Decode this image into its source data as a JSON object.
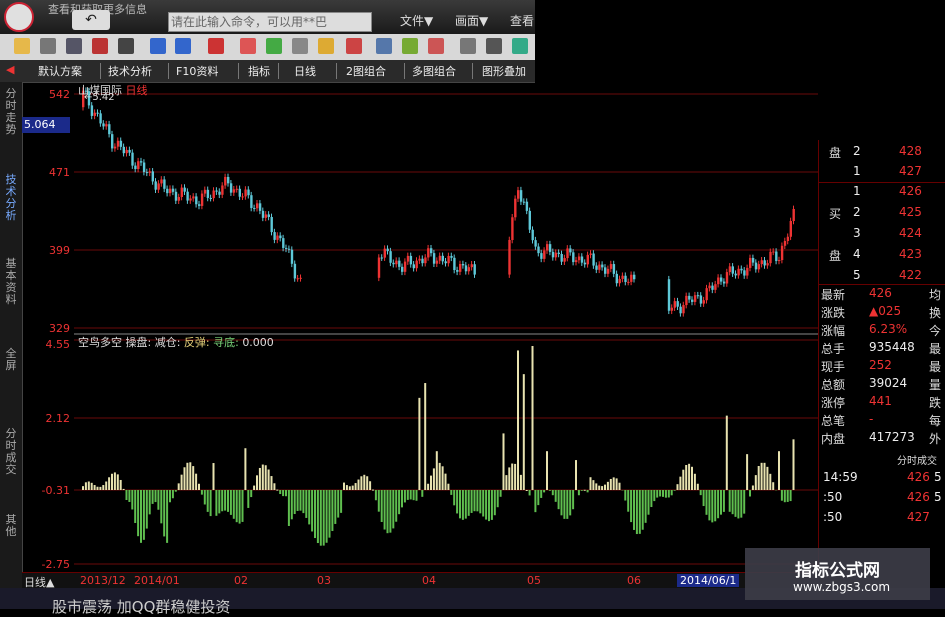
{
  "window": {
    "title": "查看和获取更多信息"
  },
  "top": {
    "back_label": "↶",
    "command_placeholder": "请在此输入命令，可以用**巴",
    "menu": [
      "文件▼",
      "画面▼",
      "查看"
    ]
  },
  "tabs": [
    "默认方案",
    "技术分析",
    "F10资料",
    "指标",
    "日线",
    "2图组合",
    "多图组合",
    "图形叠加"
  ],
  "left_tabs": [
    "分时走势",
    "技术分析",
    "基本资料",
    "全屏",
    "分时成交",
    "其他"
  ],
  "chart": {
    "stock_title": "山煤国际",
    "period": "日线",
    "max_label": "←5.42",
    "current_price": "5.064",
    "price_ticks": [
      "542",
      "471",
      "399",
      "329"
    ],
    "indicator_ticks": [
      "4.55",
      "2.12",
      "-0.31",
      "-2.75"
    ],
    "indicator": {
      "name": "空鸟多空",
      "items": [
        {
          "label": "操盘:",
          "color": "#ddd"
        },
        {
          "label": "减仓:",
          "color": "#ddd"
        },
        {
          "label": "反弹:",
          "color": "#e5d17a"
        },
        {
          "label": "寻底:",
          "color": "#7bd67b"
        },
        {
          "label": "0.000",
          "color": "#ddd"
        }
      ]
    },
    "dates": [
      "2013/12",
      "2014/01",
      "02",
      "03",
      "04",
      "05",
      "06",
      "2014/06/1"
    ],
    "period_label": "日线▲"
  },
  "right_panel": {
    "sell": [
      {
        "label": "盘",
        "num": "2",
        "price": "428"
      },
      {
        "label": "",
        "num": "1",
        "price": "427"
      }
    ],
    "buy": [
      {
        "label": "",
        "num": "1",
        "price": "426"
      },
      {
        "label": "买",
        "num": "2",
        "price": "425"
      },
      {
        "label": "",
        "num": "3",
        "price": "424"
      },
      {
        "label": "盘",
        "num": "4",
        "price": "423"
      },
      {
        "label": "",
        "num": "5",
        "price": "422"
      }
    ],
    "stats": [
      {
        "label": "最新",
        "value": "426",
        "suffix": "均"
      },
      {
        "label": "涨跌",
        "value": "▲025",
        "suffix": "换"
      },
      {
        "label": "涨幅",
        "value": "6.23%",
        "suffix": "今"
      },
      {
        "label": "总手",
        "value": "935448",
        "suffix": "最"
      },
      {
        "label": "现手",
        "value": "252",
        "suffix": "最"
      },
      {
        "label": "总额",
        "value": "39024",
        "suffix": "量"
      },
      {
        "label": "涨停",
        "value": "441",
        "suffix": "跌"
      },
      {
        "label": "总笔",
        "value": "-",
        "suffix": "每"
      },
      {
        "label": "内盘",
        "value": "417273",
        "suffix": "外"
      }
    ],
    "trades_header": "分时成交",
    "trades": [
      {
        "time": "14:59",
        "price": "426",
        "vol": "5"
      },
      {
        "time": ":50",
        "price": "426",
        "vol": "5"
      },
      {
        "time": ":50",
        "price": "427",
        "vol": ""
      }
    ]
  },
  "bottom": {
    "ticker": "股市震荡 加QQ群稳健投资"
  },
  "watermark": {
    "line1": "指标公式网",
    "line2": "www.zbgs3.com"
  },
  "colors": {
    "up": "#e33",
    "down": "#5ec8d8",
    "ind_pos": "#e8e3b0",
    "ind_neg": "#5fbf4f",
    "grid": "#6a0a0a"
  }
}
